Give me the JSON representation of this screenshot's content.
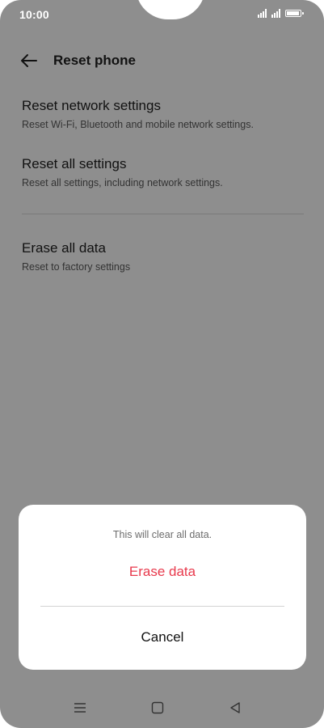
{
  "status_bar": {
    "time": "10:00",
    "signal_icons": [
      "signal-icon",
      "signal-icon"
    ],
    "battery_icon": "battery-icon",
    "battery_level": 1.0
  },
  "header": {
    "back_icon": "arrow-left-icon",
    "title": "Reset phone"
  },
  "settings": {
    "items": [
      {
        "title": "Reset network settings",
        "subtitle": "Reset Wi-Fi, Bluetooth and mobile network settings."
      },
      {
        "title": "Reset all settings",
        "subtitle": "Reset all settings, including network settings."
      },
      {
        "title": "Erase all data",
        "subtitle": "Reset to factory settings"
      }
    ]
  },
  "dialog": {
    "message": "This will clear all data.",
    "confirm_label": "Erase data",
    "cancel_label": "Cancel",
    "confirm_color": "#e8394c"
  },
  "nav_bar": {
    "icons": [
      "menu-icon",
      "home-icon",
      "back-icon"
    ]
  },
  "colors": {
    "scrim": "#8e8e8e",
    "sheet": "#ffffff"
  }
}
